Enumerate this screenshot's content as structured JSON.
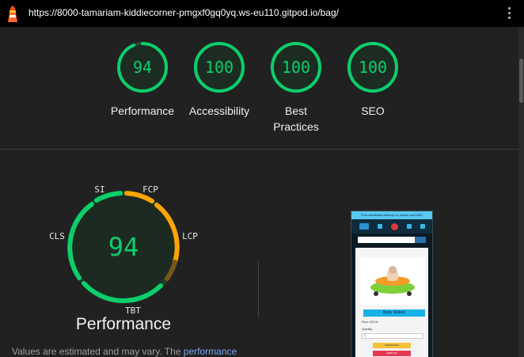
{
  "browser": {
    "url": "https://8000-tamariam-kiddiecorner-pmgxf0gq0yq.ws-eu110.gitpod.io/bag/"
  },
  "summary_scores": [
    {
      "score": "94",
      "label": "Performance"
    },
    {
      "score": "100",
      "label": "Accessibility"
    },
    {
      "score": "100",
      "label": "Best Practices"
    },
    {
      "score": "100",
      "label": "SEO"
    }
  ],
  "performance": {
    "score": "94",
    "title": "Performance",
    "metrics": {
      "si": "SI",
      "fcp": "FCP",
      "lcp": "LCP",
      "tbt": "TBT",
      "cls": "CLS"
    },
    "note_prefix": "Values are estimated and may vary. The",
    "note_link": "performance"
  },
  "thumbnail": {
    "banner": "Free worldwide delivery on orders over £60!",
    "product_title": "Baby Walker",
    "price": "Price: £25.00",
    "quantity_label": "Quantity:",
    "quantity_value": "1",
    "update_button": "UPDATE BAG",
    "remove_button": "REMOVE"
  },
  "colors": {
    "pass": "#0cce6b",
    "average": "#ffa400",
    "background": "#212121"
  }
}
